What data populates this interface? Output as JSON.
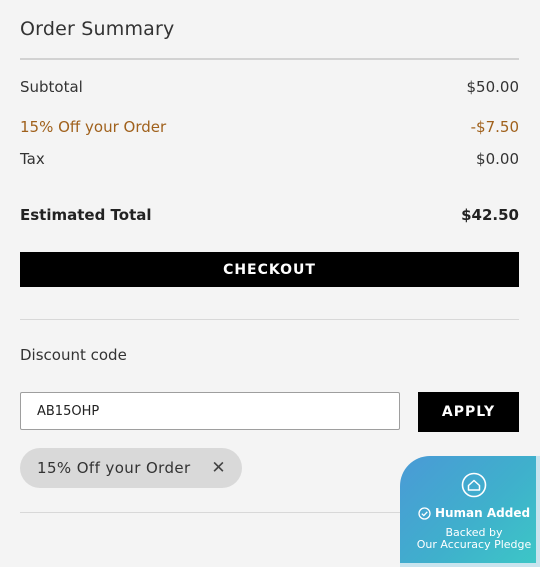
{
  "summary": {
    "title": "Order Summary",
    "rows": [
      {
        "label": "Subtotal",
        "value": "$50.00"
      },
      {
        "label": "15% Off your Order",
        "value": "-$7.50"
      },
      {
        "label": "Tax",
        "value": "$0.00"
      }
    ],
    "total": {
      "label": "Estimated Total",
      "value": "$42.50"
    },
    "checkout_label": "CHECKOUT"
  },
  "discount": {
    "label": "Discount code",
    "input_value": "AB15OHP",
    "apply_label": "APPLY",
    "applied_chip": "15% Off your Order",
    "remove_glyph": "✕"
  },
  "badge": {
    "title": "Human Added",
    "line1": "Backed by",
    "line2": "Our Accuracy Pledge"
  },
  "colors": {
    "discount_text": "#a0611c",
    "button_bg": "#000000",
    "badge_gradient_start": "#4a9ad6",
    "badge_gradient_end": "#3cc8c6"
  },
  "icons": [
    "house-icon",
    "check-circle-icon",
    "close-icon"
  ]
}
